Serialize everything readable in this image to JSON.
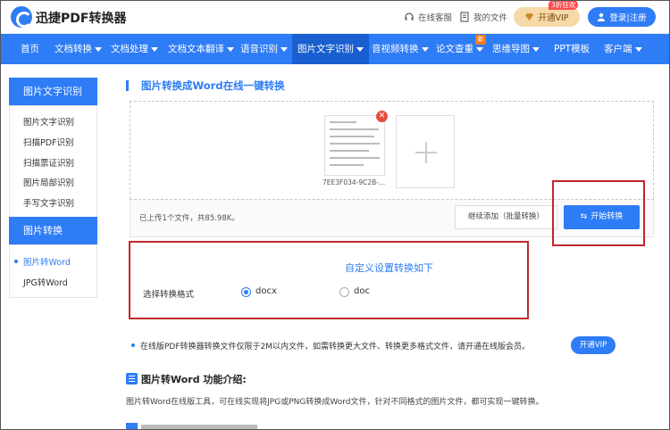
{
  "header": {
    "brand": "迅捷PDF转换器",
    "support": "在线客服",
    "my_files": "我的文件",
    "vip_badge": "3折狂欢",
    "vip_button": "开通VIP",
    "login": "登录|注册"
  },
  "nav": {
    "items": [
      {
        "label": "首页",
        "dropdown": false
      },
      {
        "label": "文档转换",
        "dropdown": true
      },
      {
        "label": "文档处理",
        "dropdown": true
      },
      {
        "label": "文档文本翻译",
        "dropdown": true
      },
      {
        "label": "语音识别",
        "dropdown": true
      },
      {
        "label": "图片文字识别",
        "dropdown": true
      },
      {
        "label": "音视频转换",
        "dropdown": true
      },
      {
        "label": "论文查重",
        "dropdown": true
      },
      {
        "label": "思维导图",
        "dropdown": true
      },
      {
        "label": "PPT模板",
        "dropdown": false
      },
      {
        "label": "客户端",
        "dropdown": true
      }
    ],
    "new_badge": "新"
  },
  "sidebar": {
    "group1_title": "图片文字识别",
    "group1_items": [
      "图片文字识别",
      "扫描PDF识别",
      "扫描票证识别",
      "图片局部识别",
      "手写文字识别"
    ],
    "group2_title": "图片转换",
    "group2_items": [
      "图片转Word",
      "JPG转Word"
    ]
  },
  "main": {
    "title": "图片转换成Word在线一键转换",
    "file_name": "7EE3F034-9C2B-...",
    "upload_info": "已上传1个文件，共85.98K。",
    "continue_button": "继续添加（批量转换）",
    "start_button": "开始转换",
    "custom_title": "自定义设置转换如下",
    "format_label": "选择转换格式",
    "formats": [
      {
        "label": "docx",
        "selected": true
      },
      {
        "label": "doc",
        "selected": false
      }
    ],
    "note": "在线版PDF转换器转换文件仅限于2M以内文件，如需转换更大文件、转换更多格式文件，请开通在线版会员。",
    "note_vip_button": "开通VIP",
    "intro_title": "图片转Word 功能介绍:",
    "intro_text": "图片转Word在线版工具，可在线实现将JPG或PNG转换成Word文件，针对不同格式的图片文件，都可实现一键转换。"
  },
  "colors": {
    "primary": "#2e7cf6",
    "highlight": "#c0282a",
    "vip_gold": "#f5d9a8"
  }
}
